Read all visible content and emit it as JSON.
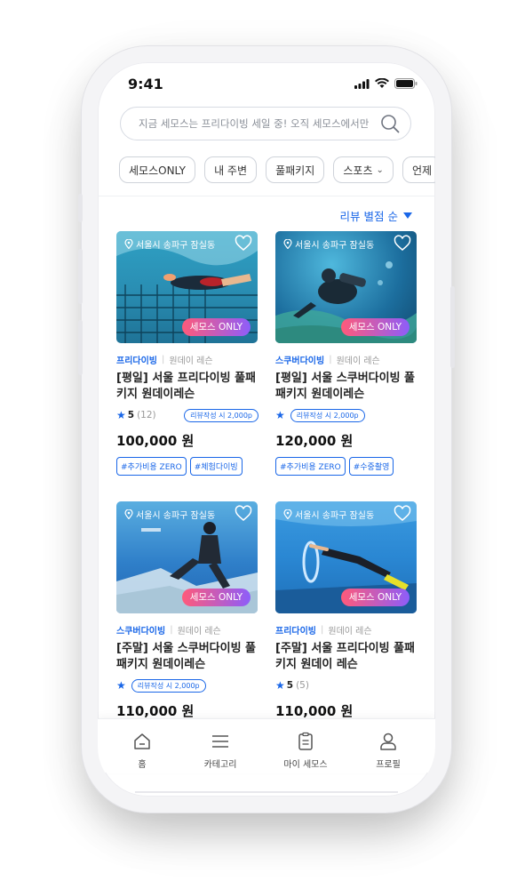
{
  "status_bar": {
    "time": "9:41"
  },
  "search": {
    "placeholder": "지금 세모스는 프리다이빙 세일 중! 오직 세모스에서만"
  },
  "filters": [
    {
      "label": "세모스ONLY"
    },
    {
      "label": "내 주변"
    },
    {
      "label": "풀패키지"
    },
    {
      "label": "스포츠"
    },
    {
      "label": "언제"
    }
  ],
  "sort": {
    "label": "리뷰 별점 순"
  },
  "cards": [
    {
      "location": "서울시 송파구 잠실동",
      "badge": "세모스 ONLY",
      "category": "프리다이빙",
      "type": "원데이 레슨",
      "title": "[평일] 서울 프리다이빙 풀패키지 원데이레슨",
      "rating": "5",
      "review_count": "(12)",
      "review_reward": "리뷰작성 시 2,000p",
      "price": "100,000 원",
      "tags": [
        "#추가비용 ZERO",
        "#체험다이빙"
      ]
    },
    {
      "location": "서울시 송파구 잠실동",
      "badge": "세모스 ONLY",
      "category": "스쿠버다이빙",
      "type": "원데이 레슨",
      "title": "[평일] 서울 스쿠버다이빙 풀패키지 원데이레슨",
      "rating": "5",
      "review_count": "(12)",
      "review_reward": "리뷰작성 시 2,000p",
      "price": "120,000 원",
      "tags": [
        "#추가비용 ZERO",
        "#수중촬영"
      ]
    },
    {
      "location": "서울시 송파구 잠실동",
      "badge": "세모스 ONLY",
      "category": "스쿠버다이빙",
      "type": "원데이 레슨",
      "title": "[주말] 서울 스쿠버다이빙 풀패키지 원데이레슨",
      "review_reward": "리뷰작성 시 2,000p",
      "price": "110,000 원"
    },
    {
      "location": "서울시 송파구 잠실동",
      "badge": "세모스 ONLY",
      "category": "프리다이빙",
      "type": "원데이 레슨",
      "title": "[주말] 서울 프리다이빙 풀패키지 원데이 레슨",
      "rating": "5",
      "review_count": "(5)",
      "price": "110,000 원"
    }
  ],
  "tabbar": [
    {
      "label": "홈",
      "icon": "home-icon"
    },
    {
      "label": "카테고리",
      "icon": "menu-icon"
    },
    {
      "label": "마이 세모스",
      "icon": "clipboard-icon"
    },
    {
      "label": "프로필",
      "icon": "user-icon"
    }
  ],
  "colors": {
    "accent": "#1a67e8",
    "badge_start": "#ff5a7a",
    "badge_end": "#8d5dfa"
  }
}
